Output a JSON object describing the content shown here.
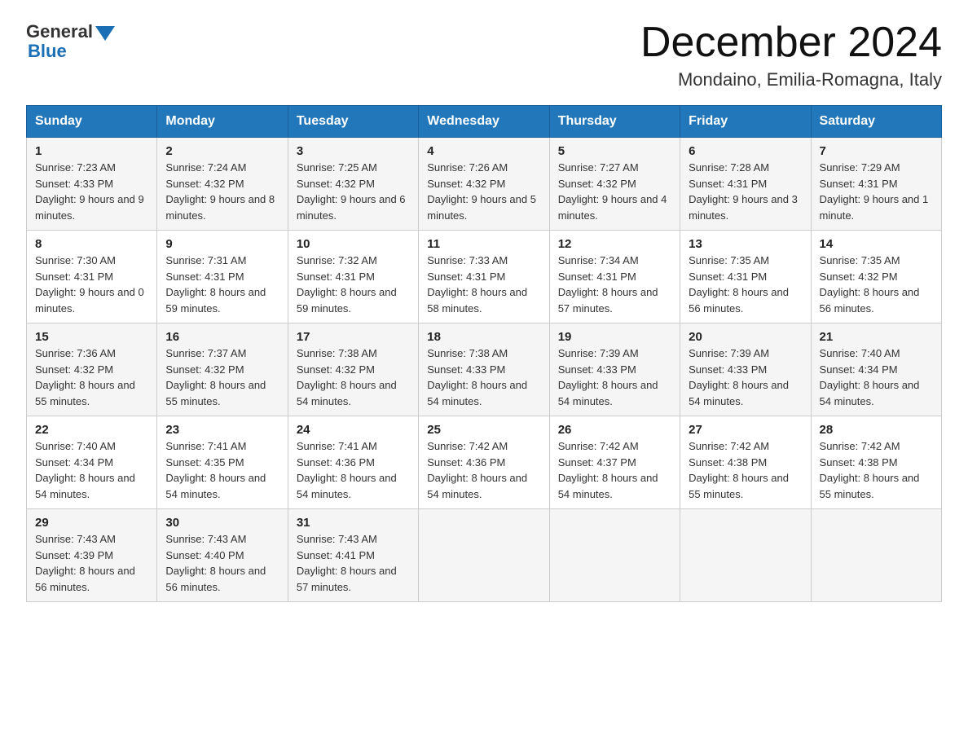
{
  "header": {
    "logo_general": "General",
    "logo_blue": "Blue",
    "month_title": "December 2024",
    "location": "Mondaino, Emilia-Romagna, Italy"
  },
  "days_of_week": [
    "Sunday",
    "Monday",
    "Tuesday",
    "Wednesday",
    "Thursday",
    "Friday",
    "Saturday"
  ],
  "weeks": [
    [
      {
        "day": "1",
        "sunrise": "7:23 AM",
        "sunset": "4:33 PM",
        "daylight": "9 hours and 9 minutes."
      },
      {
        "day": "2",
        "sunrise": "7:24 AM",
        "sunset": "4:32 PM",
        "daylight": "9 hours and 8 minutes."
      },
      {
        "day": "3",
        "sunrise": "7:25 AM",
        "sunset": "4:32 PM",
        "daylight": "9 hours and 6 minutes."
      },
      {
        "day": "4",
        "sunrise": "7:26 AM",
        "sunset": "4:32 PM",
        "daylight": "9 hours and 5 minutes."
      },
      {
        "day": "5",
        "sunrise": "7:27 AM",
        "sunset": "4:32 PM",
        "daylight": "9 hours and 4 minutes."
      },
      {
        "day": "6",
        "sunrise": "7:28 AM",
        "sunset": "4:31 PM",
        "daylight": "9 hours and 3 minutes."
      },
      {
        "day": "7",
        "sunrise": "7:29 AM",
        "sunset": "4:31 PM",
        "daylight": "9 hours and 1 minute."
      }
    ],
    [
      {
        "day": "8",
        "sunrise": "7:30 AM",
        "sunset": "4:31 PM",
        "daylight": "9 hours and 0 minutes."
      },
      {
        "day": "9",
        "sunrise": "7:31 AM",
        "sunset": "4:31 PM",
        "daylight": "8 hours and 59 minutes."
      },
      {
        "day": "10",
        "sunrise": "7:32 AM",
        "sunset": "4:31 PM",
        "daylight": "8 hours and 59 minutes."
      },
      {
        "day": "11",
        "sunrise": "7:33 AM",
        "sunset": "4:31 PM",
        "daylight": "8 hours and 58 minutes."
      },
      {
        "day": "12",
        "sunrise": "7:34 AM",
        "sunset": "4:31 PM",
        "daylight": "8 hours and 57 minutes."
      },
      {
        "day": "13",
        "sunrise": "7:35 AM",
        "sunset": "4:31 PM",
        "daylight": "8 hours and 56 minutes."
      },
      {
        "day": "14",
        "sunrise": "7:35 AM",
        "sunset": "4:32 PM",
        "daylight": "8 hours and 56 minutes."
      }
    ],
    [
      {
        "day": "15",
        "sunrise": "7:36 AM",
        "sunset": "4:32 PM",
        "daylight": "8 hours and 55 minutes."
      },
      {
        "day": "16",
        "sunrise": "7:37 AM",
        "sunset": "4:32 PM",
        "daylight": "8 hours and 55 minutes."
      },
      {
        "day": "17",
        "sunrise": "7:38 AM",
        "sunset": "4:32 PM",
        "daylight": "8 hours and 54 minutes."
      },
      {
        "day": "18",
        "sunrise": "7:38 AM",
        "sunset": "4:33 PM",
        "daylight": "8 hours and 54 minutes."
      },
      {
        "day": "19",
        "sunrise": "7:39 AM",
        "sunset": "4:33 PM",
        "daylight": "8 hours and 54 minutes."
      },
      {
        "day": "20",
        "sunrise": "7:39 AM",
        "sunset": "4:33 PM",
        "daylight": "8 hours and 54 minutes."
      },
      {
        "day": "21",
        "sunrise": "7:40 AM",
        "sunset": "4:34 PM",
        "daylight": "8 hours and 54 minutes."
      }
    ],
    [
      {
        "day": "22",
        "sunrise": "7:40 AM",
        "sunset": "4:34 PM",
        "daylight": "8 hours and 54 minutes."
      },
      {
        "day": "23",
        "sunrise": "7:41 AM",
        "sunset": "4:35 PM",
        "daylight": "8 hours and 54 minutes."
      },
      {
        "day": "24",
        "sunrise": "7:41 AM",
        "sunset": "4:36 PM",
        "daylight": "8 hours and 54 minutes."
      },
      {
        "day": "25",
        "sunrise": "7:42 AM",
        "sunset": "4:36 PM",
        "daylight": "8 hours and 54 minutes."
      },
      {
        "day": "26",
        "sunrise": "7:42 AM",
        "sunset": "4:37 PM",
        "daylight": "8 hours and 54 minutes."
      },
      {
        "day": "27",
        "sunrise": "7:42 AM",
        "sunset": "4:38 PM",
        "daylight": "8 hours and 55 minutes."
      },
      {
        "day": "28",
        "sunrise": "7:42 AM",
        "sunset": "4:38 PM",
        "daylight": "8 hours and 55 minutes."
      }
    ],
    [
      {
        "day": "29",
        "sunrise": "7:43 AM",
        "sunset": "4:39 PM",
        "daylight": "8 hours and 56 minutes."
      },
      {
        "day": "30",
        "sunrise": "7:43 AM",
        "sunset": "4:40 PM",
        "daylight": "8 hours and 56 minutes."
      },
      {
        "day": "31",
        "sunrise": "7:43 AM",
        "sunset": "4:41 PM",
        "daylight": "8 hours and 57 minutes."
      },
      null,
      null,
      null,
      null
    ]
  ],
  "labels": {
    "sunrise": "Sunrise:",
    "sunset": "Sunset:",
    "daylight": "Daylight:"
  }
}
